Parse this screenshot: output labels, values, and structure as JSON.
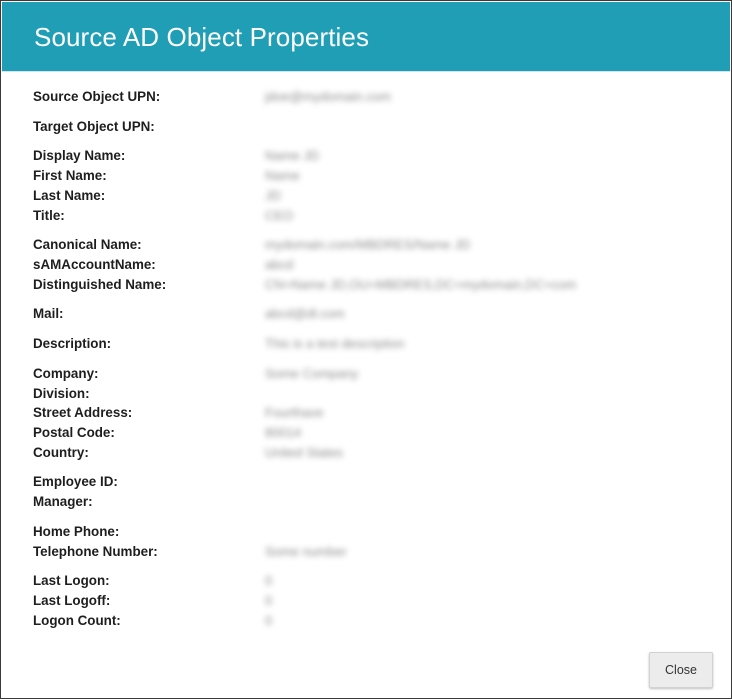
{
  "dialog": {
    "title": "Source AD Object Properties",
    "close_label": "Close"
  },
  "properties": [
    {
      "label": "Source Object UPN:",
      "value": "jdoe@mydomain.com"
    },
    {
      "label": "Target Object UPN:",
      "value": ""
    },
    {
      "label": "Display Name:",
      "value": "Name JD"
    },
    {
      "label": "First Name:",
      "value": "Name"
    },
    {
      "label": "Last Name:",
      "value": "JD"
    },
    {
      "label": "Title:",
      "value": "CEO"
    },
    {
      "label": "Canonical Name:",
      "value": "mydomain.com/MBDRES/Name JD"
    },
    {
      "label": "sAMAccountName:",
      "value": "abcd"
    },
    {
      "label": "Distinguished Name:",
      "value": "CN=Name JD,OU=MBDRES,DC=mydomain,DC=com"
    },
    {
      "label": "Mail:",
      "value": "abcd@dl.com"
    },
    {
      "label": "Description:",
      "value": "This is a test description"
    },
    {
      "label": "Company:",
      "value": "Some Company"
    },
    {
      "label": "Division:",
      "value": ""
    },
    {
      "label": "Street Address:",
      "value": "Fourthave"
    },
    {
      "label": "Postal Code:",
      "value": "80014"
    },
    {
      "label": "Country:",
      "value": "United States"
    },
    {
      "label": "Employee ID:",
      "value": ""
    },
    {
      "label": "Manager:",
      "value": ""
    },
    {
      "label": "Home Phone:",
      "value": ""
    },
    {
      "label": "Telephone Number:",
      "value": "Some number"
    },
    {
      "label": "Last Logon:",
      "value": "0"
    },
    {
      "label": "Last Logoff:",
      "value": "0"
    },
    {
      "label": "Logon Count:",
      "value": "0"
    }
  ],
  "colors": {
    "header": "#1f9eb6",
    "title_text": "#ffffff",
    "label_text": "#1e1e1e",
    "button_bg": "#ececec"
  }
}
